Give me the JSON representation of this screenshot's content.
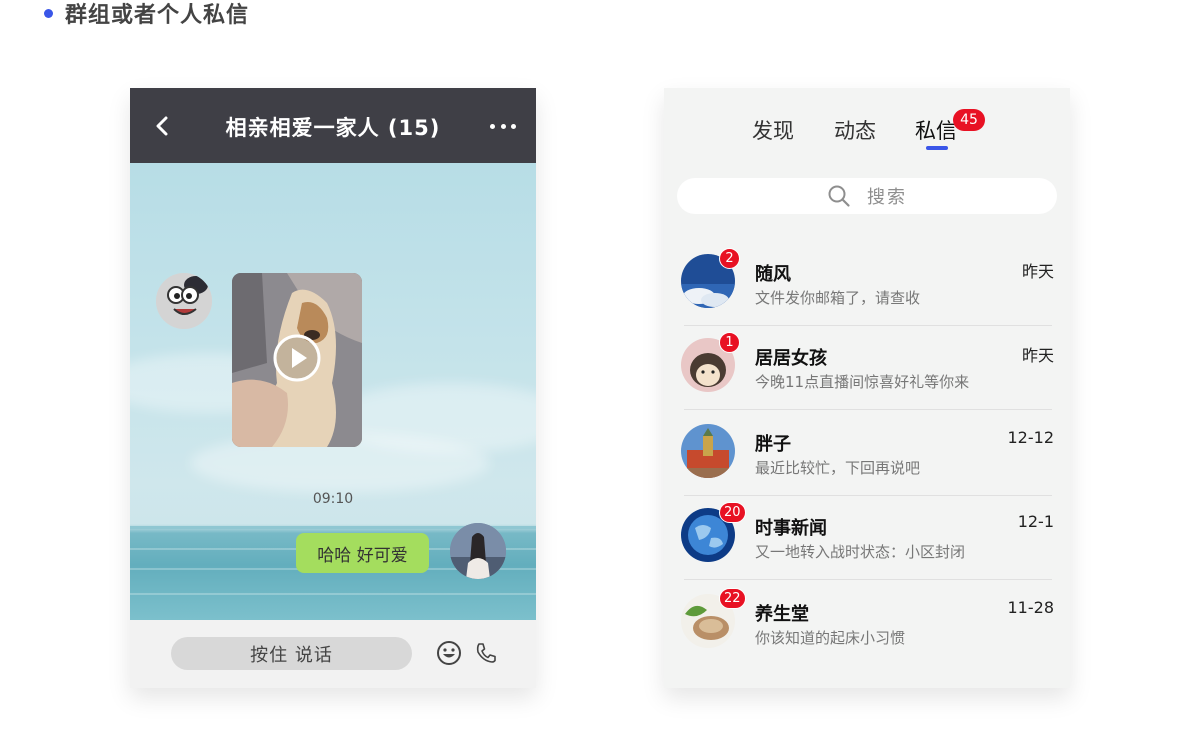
{
  "section": {
    "title": "群组或者个人私信"
  },
  "chat": {
    "title": "相亲相爱一家人 (15)",
    "timestamp": "09:10",
    "my_message": "哈哈 好可爱",
    "hold_to_talk": "按住 说话"
  },
  "messages_screen": {
    "tabs": [
      {
        "label": "发现"
      },
      {
        "label": "动态"
      },
      {
        "label": "私信",
        "badge": "45",
        "active": true
      }
    ],
    "search_placeholder": "搜索",
    "items": [
      {
        "name": "随风",
        "preview": "文件发你邮箱了，请查收",
        "time": "昨天",
        "badge": "2",
        "avatar": "sky-avatar"
      },
      {
        "name": "居居女孩",
        "preview": "今晚11点直播间惊喜好礼等你来",
        "time": "昨天",
        "badge": "1",
        "avatar": "hedgehog-avatar"
      },
      {
        "name": "胖子",
        "preview": "最近比较忙，下回再说吧",
        "time": "12-12",
        "badge": "",
        "avatar": "castle-avatar"
      },
      {
        "name": "时事新闻",
        "preview": "又一地转入战时状态：小区封闭",
        "time": "12-1",
        "badge": "20",
        "avatar": "globe-avatar"
      },
      {
        "name": "养生堂",
        "preview": "你该知道的起床小习惯",
        "time": "11-28",
        "badge": "22",
        "avatar": "food-avatar"
      }
    ]
  },
  "colors": {
    "accent": "#3a56e8",
    "badge": "#e81123",
    "chat_header": "#3f3f46",
    "bubble": "#a4dd5e"
  }
}
